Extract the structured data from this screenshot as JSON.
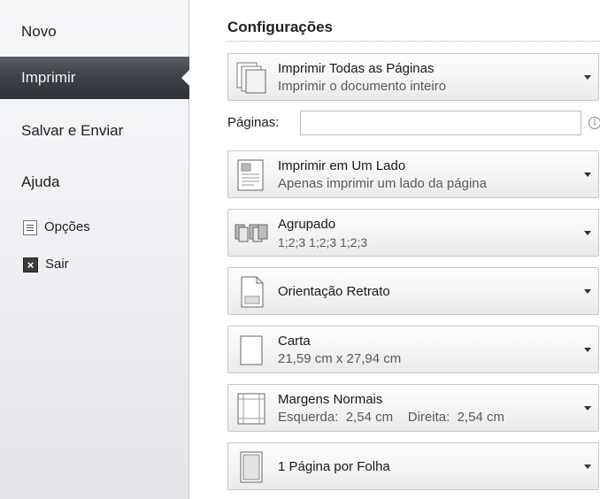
{
  "nav": {
    "items": [
      {
        "label": "Novo"
      },
      {
        "label": "Imprimir"
      },
      {
        "label": "Salvar e Enviar"
      },
      {
        "label": "Ajuda"
      }
    ],
    "small_items": [
      {
        "label": "Opções",
        "icon": "options-icon"
      },
      {
        "label": "Sair",
        "icon": "exit-icon"
      }
    ]
  },
  "settings": {
    "title": "Configurações",
    "print_what": {
      "main": "Imprimir Todas as Páginas",
      "sub": "Imprimir o documento inteiro"
    },
    "pages": {
      "label": "Páginas:",
      "value": "",
      "info": "i"
    },
    "sides": {
      "main": "Imprimir em Um Lado",
      "sub": "Apenas imprimir um lado da página"
    },
    "collate": {
      "main": "Agrupado",
      "sub": "1;2;3    1;2;3    1;2;3"
    },
    "orientation": {
      "main": "Orientação Retrato"
    },
    "paper": {
      "main": "Carta",
      "sub": "21,59 cm x 27,94 cm"
    },
    "margins": {
      "main": "Margens Normais",
      "sub": "Esquerda:  2,54 cm    Direita:  2,54 cm"
    },
    "per_sheet": {
      "main": "1 Página por Folha"
    }
  }
}
